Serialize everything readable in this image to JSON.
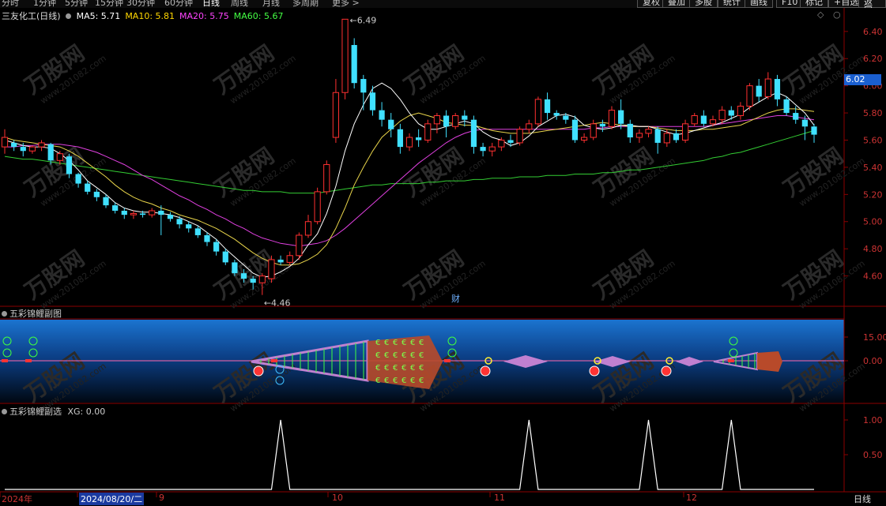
{
  "toolbar": {
    "tabs": [
      "分时",
      "1分钟",
      "5分钟",
      "15分钟",
      "30分钟",
      "60分钟",
      "日线",
      "周线",
      "月线",
      "多周期",
      "更多 >"
    ],
    "active": "日线",
    "right_buttons": [
      "复权",
      "叠加",
      "多股",
      "统计",
      "画线",
      "F10",
      "标记",
      "+自选",
      "返回"
    ]
  },
  "main_panel": {
    "title": "三友化工(日线)",
    "ma": [
      {
        "label": "MA5: 5.71",
        "color": "#ffffff"
      },
      {
        "label": "MA10: 5.81",
        "color": "#ffd700"
      },
      {
        "label": "MA20: 5.75",
        "color": "#ff44ff"
      },
      {
        "label": "MA60: 5.67",
        "color": "#44ff44"
      }
    ],
    "price_axis": [
      "6.40",
      "6.20",
      "6.00",
      "5.80",
      "5.60",
      "5.40",
      "5.20",
      "5.00",
      "4.80",
      "4.60"
    ],
    "current_price": "6.02",
    "high_label": "6.49",
    "low_label": "4.46",
    "news_marker": "财"
  },
  "sub_panel_1": {
    "title": "五彩锦鲤副图",
    "axis": [
      "15.00",
      "0.00"
    ]
  },
  "sub_panel_2": {
    "title": "五彩锦鲤副选",
    "xg": "XG: 0.00",
    "axis": [
      "1.00",
      "0.50"
    ]
  },
  "date_axis": {
    "labels": [
      "2024年",
      "2024/08/20/二",
      "9",
      "10",
      "11",
      "12"
    ],
    "period": "日线"
  },
  "watermark": {
    "brand": "万股网",
    "url": "www.201082.com"
  },
  "chart_data": {
    "type": "candlestick",
    "title": "三友化工(日线)",
    "ylim": [
      4.4,
      6.55
    ],
    "candles": [
      [
        5.55,
        5.62,
        5.5,
        5.68
      ],
      [
        5.58,
        5.55,
        5.52,
        5.6
      ],
      [
        5.55,
        5.52,
        5.48,
        5.58
      ],
      [
        5.52,
        5.55,
        5.5,
        5.56
      ],
      [
        5.55,
        5.58,
        5.52,
        5.6
      ],
      [
        5.57,
        5.45,
        5.42,
        5.58
      ],
      [
        5.45,
        5.5,
        5.42,
        5.52
      ],
      [
        5.48,
        5.35,
        5.32,
        5.5
      ],
      [
        5.35,
        5.28,
        5.25,
        5.36
      ],
      [
        5.28,
        5.22,
        5.2,
        5.3
      ],
      [
        5.22,
        5.18,
        5.15,
        5.24
      ],
      [
        5.18,
        5.12,
        5.1,
        5.2
      ],
      [
        5.12,
        5.08,
        5.06,
        5.14
      ],
      [
        5.08,
        5.05,
        5.02,
        5.1
      ],
      [
        5.05,
        5.06,
        5.02,
        5.08
      ],
      [
        5.06,
        5.05,
        5.03,
        5.08
      ],
      [
        5.05,
        5.08,
        5.03,
        5.1
      ],
      [
        5.08,
        5.05,
        4.9,
        5.12
      ],
      [
        5.05,
        5.02,
        5.0,
        5.07
      ],
      [
        5.02,
        4.98,
        4.95,
        5.04
      ],
      [
        4.98,
        4.95,
        4.92,
        5.0
      ],
      [
        4.95,
        4.9,
        4.88,
        4.97
      ],
      [
        4.9,
        4.85,
        4.82,
        4.92
      ],
      [
        4.85,
        4.78,
        4.75,
        4.87
      ],
      [
        4.78,
        4.7,
        4.68,
        4.8
      ],
      [
        4.7,
        4.62,
        4.6,
        4.72
      ],
      [
        4.62,
        4.58,
        4.55,
        4.65
      ],
      [
        4.58,
        4.55,
        4.5,
        4.6
      ],
      [
        4.55,
        4.6,
        4.46,
        4.62
      ],
      [
        4.58,
        4.72,
        4.55,
        4.75
      ],
      [
        4.72,
        4.7,
        4.68,
        4.75
      ],
      [
        4.7,
        4.75,
        4.68,
        4.78
      ],
      [
        4.75,
        4.9,
        4.72,
        4.92
      ],
      [
        4.9,
        5.0,
        4.88,
        5.05
      ],
      [
        5.0,
        5.22,
        4.98,
        5.25
      ],
      [
        5.22,
        5.42,
        5.2,
        5.45
      ],
      [
        5.62,
        5.95,
        5.58,
        6.05
      ],
      [
        5.95,
        6.49,
        5.9,
        6.49
      ],
      [
        6.3,
        6.02,
        5.98,
        6.35
      ],
      [
        6.05,
        5.95,
        5.82,
        6.08
      ],
      [
        5.95,
        5.82,
        5.78,
        6.0
      ],
      [
        5.82,
        5.75,
        5.7,
        5.88
      ],
      [
        5.75,
        5.68,
        5.62,
        5.8
      ],
      [
        5.68,
        5.55,
        5.5,
        5.72
      ],
      [
        5.55,
        5.62,
        5.52,
        5.65
      ],
      [
        5.62,
        5.6,
        5.55,
        5.68
      ],
      [
        5.6,
        5.72,
        5.58,
        5.75
      ],
      [
        5.72,
        5.78,
        5.65,
        5.8
      ],
      [
        5.78,
        5.7,
        5.62,
        5.82
      ],
      [
        5.7,
        5.78,
        5.68,
        5.8
      ],
      [
        5.78,
        5.75,
        5.7,
        5.82
      ],
      [
        5.75,
        5.55,
        5.5,
        5.78
      ],
      [
        5.55,
        5.52,
        5.48,
        5.58
      ],
      [
        5.52,
        5.55,
        5.48,
        5.58
      ],
      [
        5.55,
        5.6,
        5.52,
        5.62
      ],
      [
        5.6,
        5.58,
        5.55,
        5.64
      ],
      [
        5.58,
        5.68,
        5.56,
        5.7
      ],
      [
        5.68,
        5.72,
        5.65,
        5.75
      ],
      [
        5.72,
        5.9,
        5.7,
        5.92
      ],
      [
        5.9,
        5.8,
        5.75,
        5.95
      ],
      [
        5.8,
        5.78,
        5.75,
        5.82
      ],
      [
        5.78,
        5.75,
        5.72,
        5.8
      ],
      [
        5.75,
        5.6,
        5.58,
        5.78
      ],
      [
        5.6,
        5.62,
        5.58,
        5.65
      ],
      [
        5.62,
        5.72,
        5.6,
        5.75
      ],
      [
        5.72,
        5.7,
        5.66,
        5.75
      ],
      [
        5.7,
        5.82,
        5.68,
        5.85
      ],
      [
        5.82,
        5.72,
        5.68,
        5.9
      ],
      [
        5.72,
        5.62,
        5.58,
        5.75
      ],
      [
        5.62,
        5.65,
        5.58,
        5.68
      ],
      [
        5.65,
        5.68,
        5.62,
        5.7
      ],
      [
        5.68,
        5.58,
        5.5,
        5.7
      ],
      [
        5.58,
        5.65,
        5.55,
        5.68
      ],
      [
        5.65,
        5.6,
        5.58,
        5.68
      ],
      [
        5.6,
        5.72,
        5.58,
        5.75
      ],
      [
        5.72,
        5.78,
        5.7,
        5.8
      ],
      [
        5.78,
        5.72,
        5.7,
        5.82
      ],
      [
        5.72,
        5.75,
        5.7,
        5.78
      ],
      [
        5.75,
        5.82,
        5.72,
        5.85
      ],
      [
        5.82,
        5.78,
        5.75,
        5.85
      ],
      [
        5.78,
        5.85,
        5.75,
        5.88
      ],
      [
        5.85,
        6.0,
        5.82,
        6.02
      ],
      [
        6.0,
        5.92,
        5.88,
        6.05
      ],
      [
        5.92,
        6.05,
        5.9,
        6.1
      ],
      [
        6.05,
        5.9,
        5.85,
        6.08
      ],
      [
        5.9,
        5.8,
        5.78,
        5.92
      ],
      [
        5.8,
        5.75,
        5.72,
        5.85
      ],
      [
        5.75,
        5.7,
        5.6,
        5.78
      ],
      [
        5.7,
        5.64,
        5.58,
        5.72
      ]
    ],
    "ma5": [
      5.6,
      5.58,
      5.56,
      5.55,
      5.55,
      5.54,
      5.5,
      5.45,
      5.38,
      5.3,
      5.25,
      5.2,
      5.14,
      5.1,
      5.08,
      5.07,
      5.07,
      5.06,
      5.05,
      5.03,
      5.0,
      4.97,
      4.92,
      4.87,
      4.8,
      4.74,
      4.68,
      4.62,
      4.59,
      4.6,
      4.63,
      4.67,
      4.73,
      4.83,
      4.91,
      5.06,
      5.26,
      5.52,
      5.72,
      5.86,
      5.98,
      6.02,
      5.98,
      5.9,
      5.8,
      5.72,
      5.68,
      5.68,
      5.7,
      5.72,
      5.74,
      5.72,
      5.66,
      5.62,
      5.6,
      5.56,
      5.58,
      5.63,
      5.7,
      5.74,
      5.78,
      5.79,
      5.77,
      5.71,
      5.69,
      5.68,
      5.69,
      5.71,
      5.71,
      5.7,
      5.7,
      5.68,
      5.66,
      5.64,
      5.65,
      5.67,
      5.69,
      5.71,
      5.73,
      5.76,
      5.79,
      5.84,
      5.88,
      5.92,
      5.95,
      5.92,
      5.86,
      5.8,
      5.71
    ],
    "ma10": [
      5.62,
      5.6,
      5.59,
      5.58,
      5.57,
      5.56,
      5.55,
      5.52,
      5.48,
      5.43,
      5.38,
      5.33,
      5.27,
      5.22,
      5.18,
      5.15,
      5.13,
      5.1,
      5.08,
      5.05,
      5.03,
      5.01,
      4.98,
      4.95,
      4.91,
      4.87,
      4.82,
      4.77,
      4.73,
      4.7,
      4.68,
      4.68,
      4.69,
      4.72,
      4.76,
      4.83,
      4.95,
      5.1,
      5.27,
      5.4,
      5.52,
      5.62,
      5.68,
      5.74,
      5.78,
      5.8,
      5.78,
      5.76,
      5.73,
      5.72,
      5.71,
      5.71,
      5.69,
      5.67,
      5.66,
      5.65,
      5.65,
      5.65,
      5.66,
      5.67,
      5.68,
      5.69,
      5.7,
      5.71,
      5.72,
      5.73,
      5.72,
      5.71,
      5.7,
      5.7,
      5.7,
      5.69,
      5.68,
      5.67,
      5.67,
      5.67,
      5.68,
      5.68,
      5.69,
      5.7,
      5.71,
      5.74,
      5.77,
      5.8,
      5.82,
      5.83,
      5.83,
      5.82,
      5.81
    ],
    "ma20": [
      5.55,
      5.55,
      5.56,
      5.56,
      5.57,
      5.57,
      5.57,
      5.56,
      5.55,
      5.53,
      5.51,
      5.48,
      5.45,
      5.42,
      5.38,
      5.34,
      5.31,
      5.27,
      5.23,
      5.19,
      5.16,
      5.12,
      5.09,
      5.05,
      5.02,
      4.98,
      4.95,
      4.91,
      4.88,
      4.86,
      4.84,
      4.83,
      4.82,
      4.83,
      4.84,
      4.86,
      4.9,
      4.95,
      5.01,
      5.07,
      5.13,
      5.19,
      5.25,
      5.31,
      5.37,
      5.43,
      5.48,
      5.53,
      5.58,
      5.62,
      5.65,
      5.67,
      5.68,
      5.68,
      5.68,
      5.68,
      5.68,
      5.68,
      5.68,
      5.68,
      5.68,
      5.68,
      5.68,
      5.68,
      5.69,
      5.69,
      5.7,
      5.7,
      5.7,
      5.7,
      5.7,
      5.7,
      5.7,
      5.7,
      5.7,
      5.7,
      5.7,
      5.71,
      5.72,
      5.73,
      5.74,
      5.75,
      5.76,
      5.77,
      5.78,
      5.78,
      5.77,
      5.76,
      5.75
    ],
    "ma60": [
      5.48,
      5.47,
      5.46,
      5.46,
      5.45,
      5.44,
      5.43,
      5.42,
      5.41,
      5.4,
      5.39,
      5.38,
      5.37,
      5.36,
      5.35,
      5.34,
      5.33,
      5.32,
      5.31,
      5.3,
      5.29,
      5.28,
      5.27,
      5.26,
      5.25,
      5.24,
      5.23,
      5.23,
      5.22,
      5.22,
      5.22,
      5.21,
      5.21,
      5.21,
      5.21,
      5.22,
      5.23,
      5.24,
      5.25,
      5.26,
      5.27,
      5.27,
      5.28,
      5.28,
      5.28,
      5.28,
      5.29,
      5.29,
      5.3,
      5.3,
      5.3,
      5.31,
      5.31,
      5.32,
      5.32,
      5.32,
      5.33,
      5.33,
      5.33,
      5.34,
      5.34,
      5.34,
      5.35,
      5.35,
      5.35,
      5.36,
      5.36,
      5.37,
      5.38,
      5.38,
      5.39,
      5.4,
      5.41,
      5.42,
      5.43,
      5.44,
      5.45,
      5.47,
      5.48,
      5.5,
      5.51,
      5.53,
      5.55,
      5.57,
      5.59,
      5.61,
      5.63,
      5.65,
      5.67
    ],
    "xg_signals": [
      30,
      57,
      70,
      79
    ]
  }
}
